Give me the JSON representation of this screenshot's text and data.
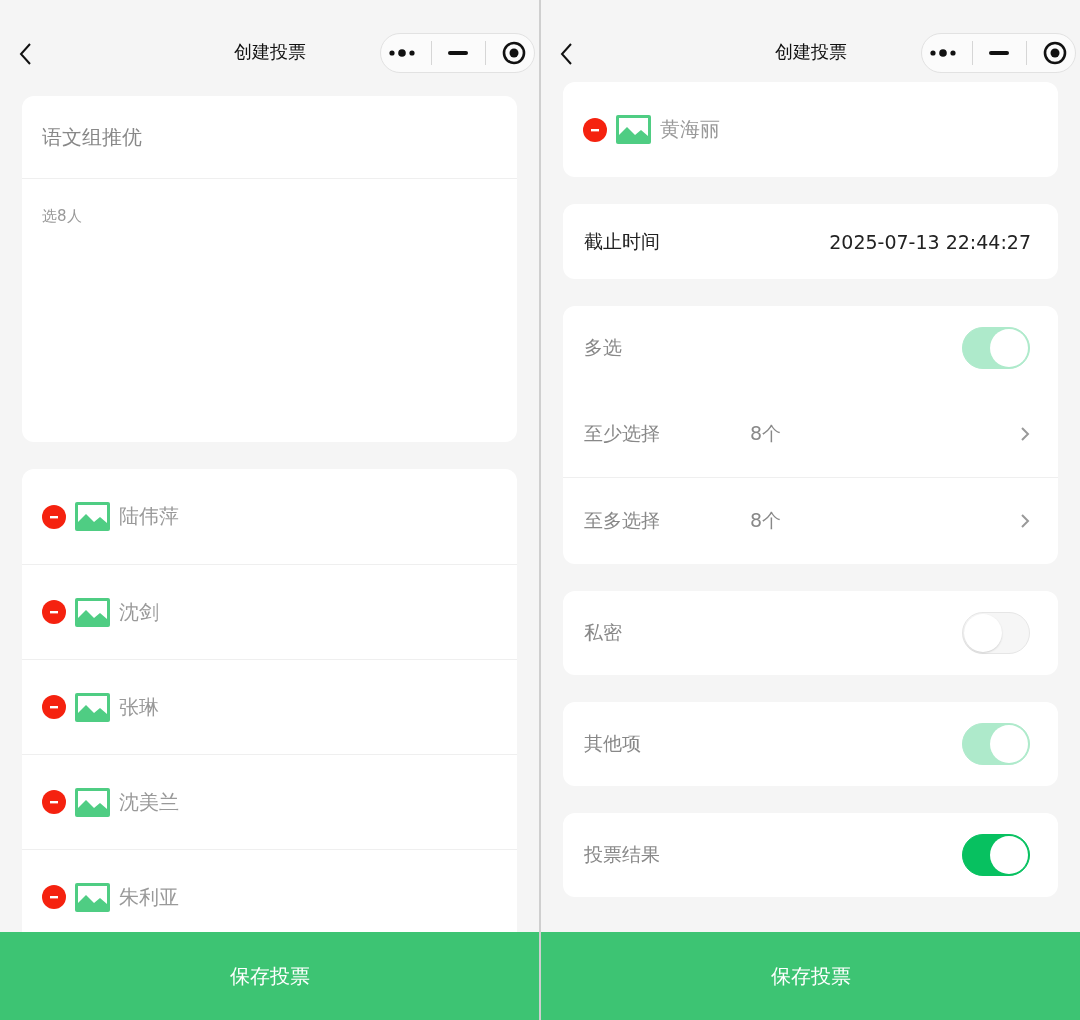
{
  "panels": [
    {
      "nav": {
        "title": "创建投票"
      },
      "title_field": {
        "value": "语文组推优"
      },
      "description_field": {
        "value": "选8人"
      },
      "candidates": [
        {
          "name": "陆伟萍"
        },
        {
          "name": "沈剑"
        },
        {
          "name": "张琳"
        },
        {
          "name": "沈美兰"
        },
        {
          "name": "朱利亚"
        }
      ],
      "save_button": {
        "label": "保存投票"
      }
    },
    {
      "nav": {
        "title": "创建投票"
      },
      "candidates": [
        {
          "name": "黄海丽"
        }
      ],
      "deadline": {
        "label": "截止时间",
        "value": "2025-07-13 22:44:27"
      },
      "setting_cards": [
        {
          "rows": [
            {
              "kind": "toggle",
              "label": "多选",
              "on": true,
              "disabled": true
            },
            {
              "kind": "picker",
              "label": "至少选择",
              "value": "8个"
            },
            {
              "kind": "picker",
              "label": "至多选择",
              "value": "8个"
            }
          ]
        },
        {
          "rows": [
            {
              "kind": "toggle",
              "label": "私密",
              "on": false,
              "disabled": false
            }
          ]
        },
        {
          "rows": [
            {
              "kind": "toggle",
              "label": "其他项",
              "on": true,
              "disabled": true
            }
          ]
        },
        {
          "rows": [
            {
              "kind": "toggle",
              "label": "投票结果",
              "on": true,
              "disabled": false
            }
          ]
        }
      ],
      "save_button": {
        "label": "保存投票"
      }
    }
  ]
}
